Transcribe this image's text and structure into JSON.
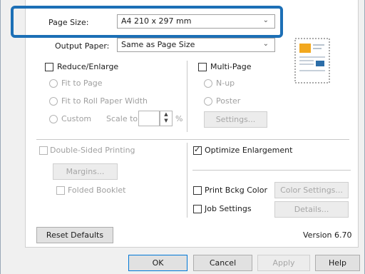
{
  "page_size": {
    "label": "Page Size:",
    "value": "A4 210 x 297 mm"
  },
  "output_paper": {
    "label": "Output Paper:",
    "value": "Same as Page Size"
  },
  "reduce_enlarge": {
    "label": "Reduce/Enlarge",
    "fit_to_page": "Fit to Page",
    "fit_to_roll": "Fit to Roll Paper Width",
    "custom": "Custom",
    "scale_to": "Scale to",
    "percent": "%"
  },
  "multi_page": {
    "label": "Multi-Page",
    "n_up": "N-up",
    "poster": "Poster",
    "settings": "Settings..."
  },
  "double_sided": {
    "label": "Double-Sided Printing",
    "margins": "Margins...",
    "folded_booklet": "Folded Booklet"
  },
  "optimize_enlargement": {
    "label": "Optimize Enlargement",
    "checked": true
  },
  "print_bckg_color": {
    "label": "Print Bckg Color",
    "color_settings": "Color Settings..."
  },
  "job_settings": {
    "label": "Job Settings",
    "details": "Details..."
  },
  "reset_defaults": "Reset Defaults",
  "version": "Version 6.70",
  "footer_buttons": {
    "ok": "OK",
    "cancel": "Cancel",
    "apply": "Apply",
    "help": "Help"
  },
  "highlight_color": "#1c6fb6"
}
